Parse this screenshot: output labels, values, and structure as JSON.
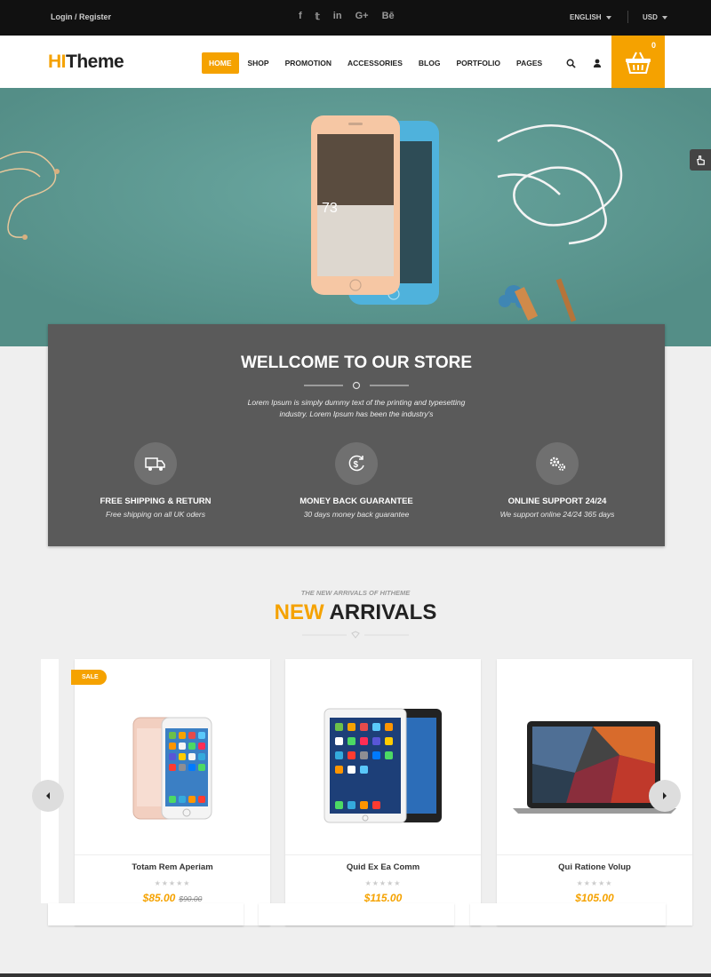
{
  "topbar": {
    "login_register": "Login / Register",
    "social_icons": [
      "facebook-icon",
      "twitter-icon",
      "linkedin-icon",
      "google-plus-icon",
      "behance-icon"
    ],
    "social_glyphs": [
      "f",
      "𝕥",
      "in",
      "G+",
      "Bē"
    ],
    "language": "ENGLISH",
    "currency": "USD"
  },
  "header": {
    "logo_hi": "HI",
    "logo_theme": "Theme",
    "nav": [
      "HOME",
      "SHOP",
      "PROMOTION",
      "ACCESSORIES",
      "BLOG",
      "PORTFOLIO",
      "PAGES"
    ],
    "active_nav": "HOME",
    "cart_count": "0"
  },
  "hero": {
    "phone_temp": "73"
  },
  "welcome": {
    "title": "WELLCOME TO OUR STORE",
    "description": "Lorem Ipsum is simply dummy text of the printing and typesetting industry. Lorem Ipsum has been the industry's",
    "features": [
      {
        "icon": "truck-icon",
        "title": "FREE SHIPPING & RETURN",
        "desc": "Free shipping on all UK oders"
      },
      {
        "icon": "money-back-icon",
        "title": "MONEY BACK GUARANTEE",
        "desc": "30 days money back guarantee"
      },
      {
        "icon": "gears-icon",
        "title": "ONLINE SUPPORT 24/24",
        "desc": "We support online 24/24 365 days"
      }
    ]
  },
  "arrivals": {
    "subtitle": "THE NEW ARRIVALS OF HITHEME",
    "title_highlight": "NEW",
    "title_rest": "ARRIVALS",
    "products": [
      {
        "name": "Totam Rem Aperiam",
        "price": "$85.00",
        "old_price": "$90.00",
        "badge": "SALE",
        "image": "iphone-image"
      },
      {
        "name": "Quid Ex Ea Comm",
        "price": "$115.00",
        "old_price": "",
        "badge": "",
        "image": "ipad-image"
      },
      {
        "name": "Qui Ratione Volup",
        "price": "$105.00",
        "old_price": "",
        "badge": "",
        "image": "macbook-image"
      }
    ]
  },
  "colors": {
    "accent": "#f5a200",
    "topbar": "#111111",
    "hero": "#5f9c94",
    "welcome_panel": "#5a5a5a"
  }
}
